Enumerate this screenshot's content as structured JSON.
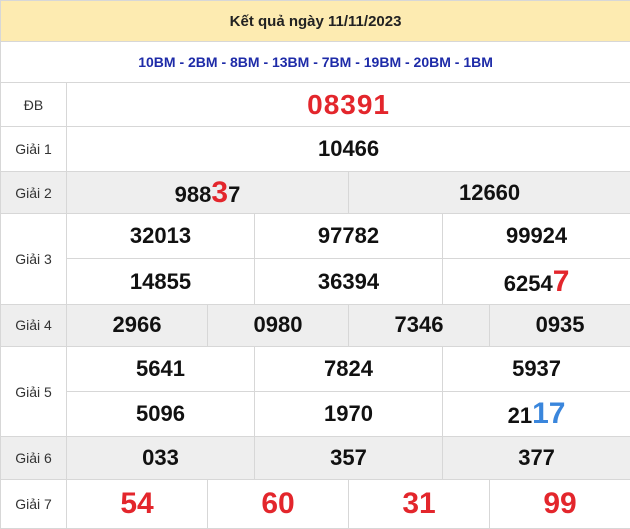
{
  "title": "Kết quả ngày 11/11/2023",
  "codes": "10BM - 2BM - 8BM - 13BM - 7BM - 19BM - 20BM - 1BM",
  "labels": {
    "db": "ĐB",
    "g1": "Giải 1",
    "g2": "Giải 2",
    "g3": "Giải 3",
    "g4": "Giải 4",
    "g5": "Giải 5",
    "g6": "Giải 6",
    "g7": "Giải 7"
  },
  "prizes": {
    "db": "08391",
    "g1": "10466",
    "g2": [
      {
        "prefix": "988",
        "hl": "3",
        "suffix": "7"
      },
      {
        "value": "12660"
      }
    ],
    "g3": [
      "32013",
      "97782",
      "99924",
      "14855",
      "36394",
      {
        "prefix": "6254",
        "hl": "7"
      }
    ],
    "g4": [
      "2966",
      "0980",
      "7346",
      "0935"
    ],
    "g5": [
      "5641",
      "7824",
      "5937",
      "5096",
      "1970",
      {
        "prefix": "21",
        "hl": "17"
      }
    ],
    "g6": [
      "033",
      "357",
      "377"
    ],
    "g7": [
      "54",
      "60",
      "31",
      "99"
    ]
  },
  "colors": {
    "header_bg": "#fdebb1",
    "code_text": "#1e2ba8",
    "highlight_red": "#e3262c",
    "highlight_blue": "#3a86dc",
    "alt_row_bg": "#eeeeee"
  }
}
